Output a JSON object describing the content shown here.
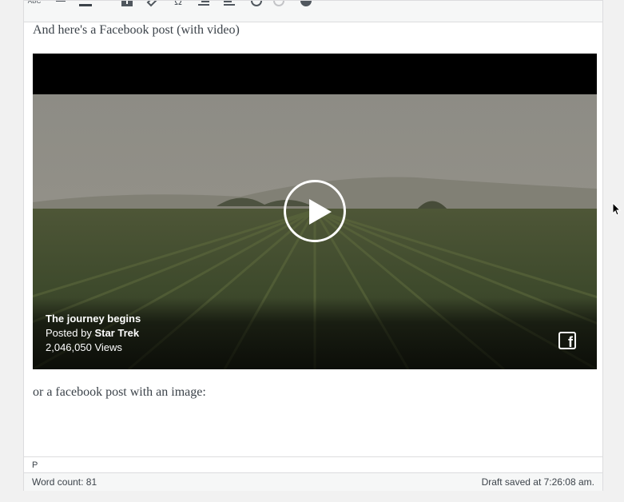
{
  "toolbar": {
    "buttons": [
      {
        "name": "spellcheck-icon",
        "glyph": "ABC"
      },
      {
        "name": "horizontal-line-icon"
      },
      {
        "name": "text-color-icon",
        "glyph": "A"
      },
      {
        "name": "text-color-dropdown-icon"
      },
      {
        "name": "paste-text-icon"
      },
      {
        "name": "clear-formatting-icon"
      },
      {
        "name": "special-character-icon",
        "glyph": "Ω"
      },
      {
        "name": "outdent-icon"
      },
      {
        "name": "indent-icon"
      },
      {
        "name": "undo-icon"
      },
      {
        "name": "redo-icon"
      },
      {
        "name": "help-icon"
      }
    ]
  },
  "content": {
    "intro_text": "And here's a Facebook post (with video)",
    "outro_text": "or a facebook post with an image:"
  },
  "video": {
    "title": "The journey begins",
    "posted_by_prefix": "Posted by",
    "author": "Star Trek",
    "views": "2,046,050 Views",
    "fb_glyph": "f"
  },
  "statusbar": {
    "path": "P"
  },
  "footer": {
    "word_count": "Word count: 81",
    "draft_status": "Draft saved at 7:26:08 am."
  }
}
